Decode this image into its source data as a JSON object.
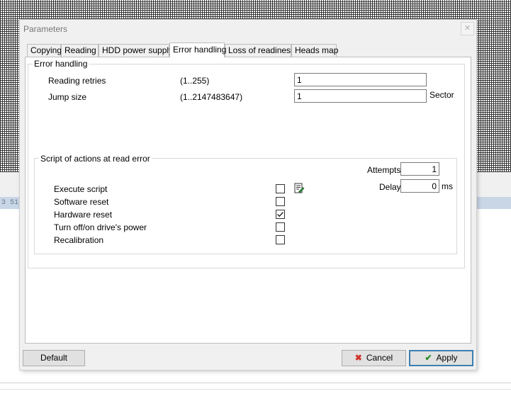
{
  "window": {
    "title": "Parameters",
    "close_glyph": "✕"
  },
  "background": {
    "hex_fragment": "3 51"
  },
  "tabs": [
    {
      "label": "Copying"
    },
    {
      "label": "Reading"
    },
    {
      "label": "HDD power supply"
    },
    {
      "label": "Error handling"
    },
    {
      "label": "Loss of readiness"
    },
    {
      "label": "Heads map"
    }
  ],
  "active_tab": "Error handling",
  "error_handling": {
    "group_title": "Error handling",
    "reading_retries": {
      "label": "Reading retries",
      "range": "(1..255)",
      "value": "1"
    },
    "jump_size": {
      "label": "Jump size",
      "range": "(1..2147483647)",
      "value": "1",
      "unit": "Sector"
    }
  },
  "script_group": {
    "title": "Script of actions at read error",
    "attempts": {
      "label": "Attempts",
      "value": "1"
    },
    "delay": {
      "label": "Delay",
      "value": "0",
      "unit": "ms"
    },
    "options": [
      {
        "label": "Execute script",
        "checked": false
      },
      {
        "label": "Software reset",
        "checked": false
      },
      {
        "label": "Hardware reset",
        "checked": true
      },
      {
        "label": "Turn off/on drive's power",
        "checked": false
      },
      {
        "label": "Recalibration",
        "checked": false
      }
    ],
    "script_icon": "script-edit-icon"
  },
  "buttons": {
    "default": "Default",
    "cancel": "Cancel",
    "apply": "Apply"
  },
  "colors": {
    "cancel_icon": "#d0342c",
    "apply_icon": "#2c8a2c",
    "accent_border": "#3c7fb1"
  }
}
